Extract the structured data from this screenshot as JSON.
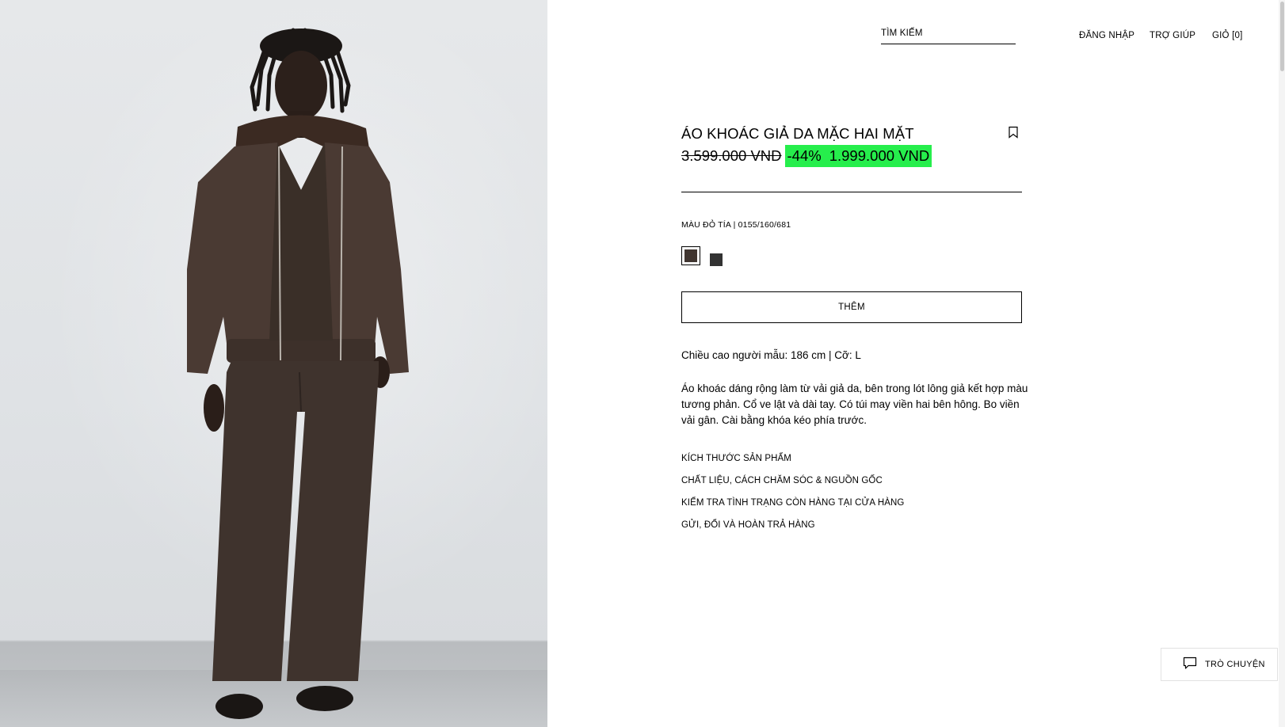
{
  "header": {
    "search_label": "TÌM KIẾM",
    "login_label": "ĐĂNG NHẬP",
    "help_label": "TRỢ GIÚP",
    "cart_label": "GIỎ [0]"
  },
  "product": {
    "title": "ÁO KHOÁC GIẢ DA MẶC HAI MẶT",
    "price_original": "3.599.000 VND",
    "discount": "-44%",
    "price_sale": "1.999.000 VND",
    "color_label": "MÀU ĐỎ TÍA | 0155/160/681",
    "swatches": [
      {
        "color": "#403530",
        "selected": true
      },
      {
        "color": "#333333",
        "selected": false
      }
    ],
    "add_label": "THÊM",
    "model_info": "Chiều cao người mẫu: 186 cm | Cỡ: L",
    "description": "Áo khoác dáng rộng làm từ vải giả da, bên trong lót lông giả kết hợp màu tương phản. Cổ ve lật và dài tay. Có túi may viền hai bên hông. Bo viền vải gân. Cài bằng khóa kéo phía trước.",
    "accordion": [
      "KÍCH THƯỚC SẢN PHẨM",
      "CHẤT LIỆU, CÁCH CHĂM SÓC & NGUỒN GỐC",
      "KIỂM TRA TÌNH TRẠNG CÒN HÀNG TẠI CỬA HÀNG",
      "GỬI, ĐỔI VÀ HOÀN TRẢ HÀNG"
    ]
  },
  "chat": {
    "label": "TRÒ CHUYỆN"
  },
  "colors": {
    "sale_highlight": "#26ee4c",
    "jacket": "#4a3a33",
    "trousers": "#3f332d"
  },
  "icons": {
    "bookmark": "bookmark-icon",
    "chat": "chat-bubble-icon"
  }
}
